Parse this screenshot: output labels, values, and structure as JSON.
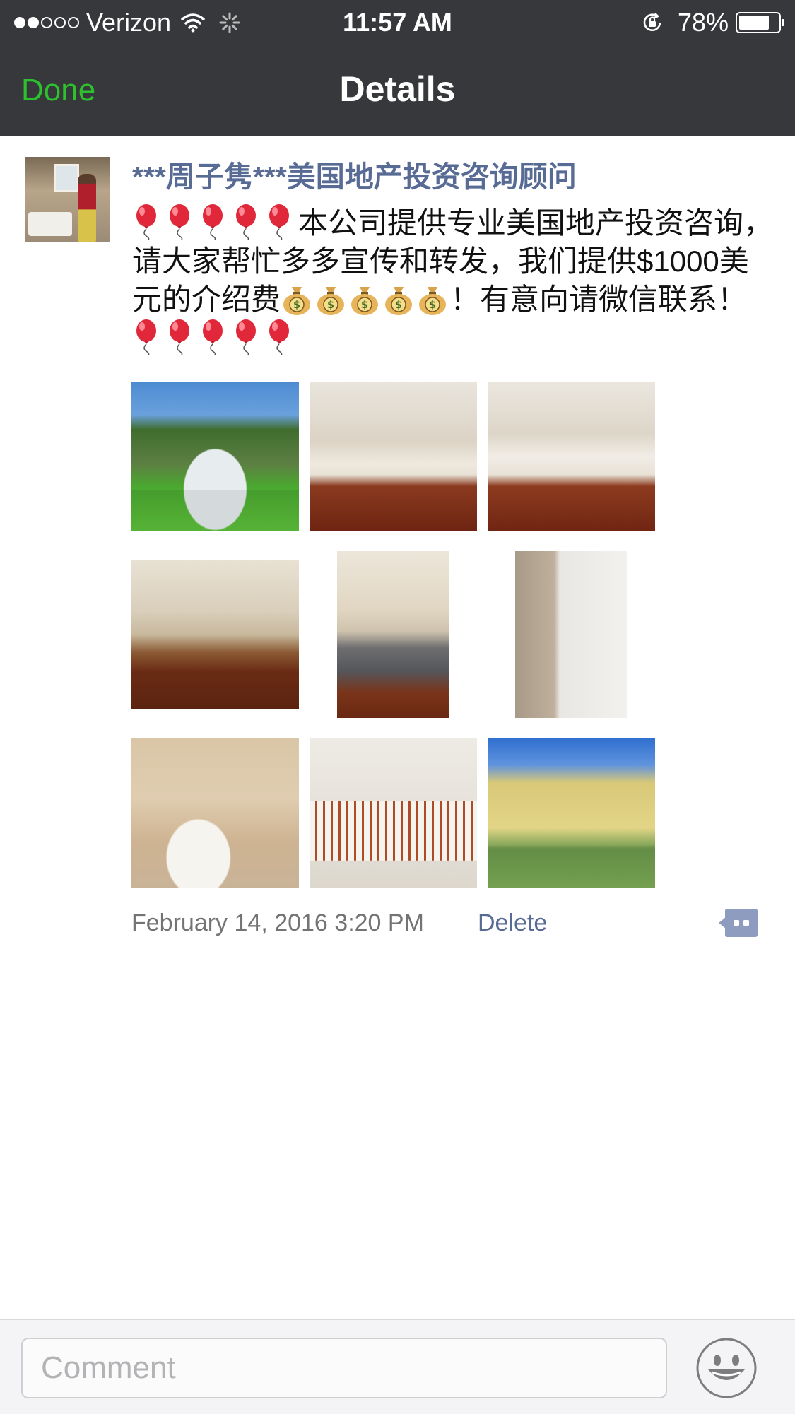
{
  "status_bar": {
    "carrier": "Verizon",
    "signal_bars_filled": 2,
    "signal_bars_total": 5,
    "time": "11:57 AM",
    "battery": "78%",
    "battery_level": 0.78
  },
  "nav": {
    "done_label": "Done",
    "title": "Details"
  },
  "post": {
    "author": "***周子隽***美国地产投资咨询顾问",
    "text_part1": "本公司提供专业美国地产投资咨询，请大家帮忙多多宣传和转发，我们提供$1000美元的介绍费",
    "text_part2": "！有意向请微信联系！",
    "emoji_balloon": "🎈",
    "emoji_moneybag": "💰",
    "photo_count": 9,
    "timestamp": "February 14, 2016 3:20 PM",
    "delete_label": "Delete"
  },
  "comment_bar": {
    "placeholder": "Comment"
  },
  "colors": {
    "nav_bg": "#37383b",
    "done_green": "#2dc22d",
    "link_blue": "#576b95",
    "meta_gray": "#737373"
  },
  "icons": {
    "wifi": "wifi-icon",
    "activity": "activity-spinner-icon",
    "lock": "rotation-lock-icon",
    "battery": "battery-icon",
    "comment_action": "comment-action-icon",
    "emoji": "smiley-face-icon"
  }
}
